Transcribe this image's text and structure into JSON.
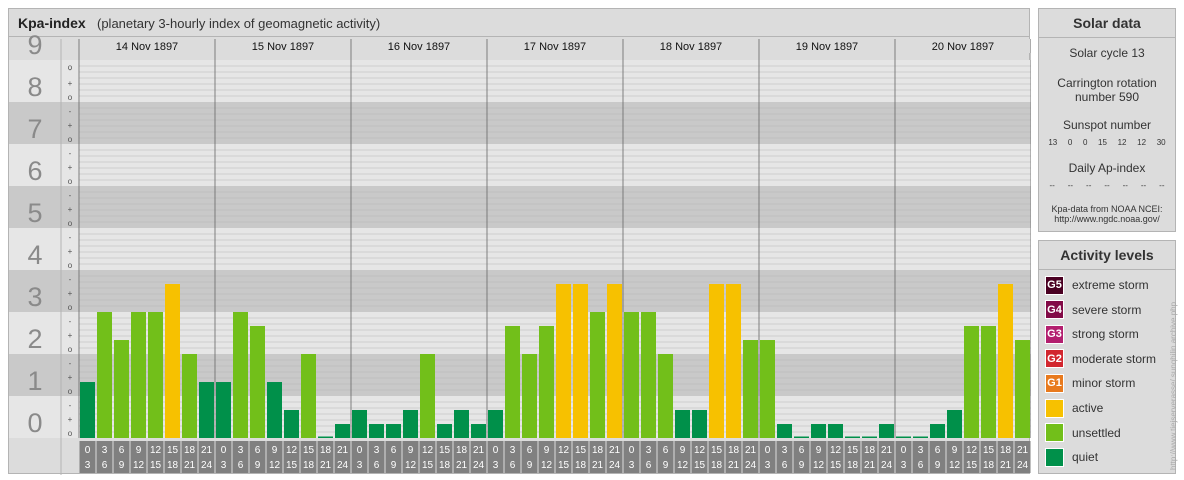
{
  "header": {
    "title": "Kpa-index",
    "subtitle": "(planetary 3-hourly index of geomagnetic activity)"
  },
  "colors": {
    "quiet": "#00904a",
    "unsettled": "#72bf1a",
    "active": "#f7c100",
    "G1": "#e87a1e",
    "G2": "#d2262e",
    "G3": "#b31f6f",
    "G4": "#820a47",
    "G5": "#4a0022"
  },
  "chart_data": {
    "type": "bar",
    "ylim": [
      0,
      9
    ],
    "y_ticks": [
      "0",
      "1",
      "2",
      "3",
      "4",
      "5",
      "6",
      "7",
      "8",
      "9"
    ],
    "thirds_labels": [
      "o",
      "+",
      "-"
    ],
    "days": [
      "14 Nov 1897",
      "15 Nov 1897",
      "16 Nov 1897",
      "17 Nov 1897",
      "18 Nov 1897",
      "19 Nov 1897",
      "20 Nov 1897"
    ],
    "interval_labels": [
      [
        "0",
        "3"
      ],
      [
        "3",
        "6"
      ],
      [
        "6",
        "9"
      ],
      [
        "9",
        "12"
      ],
      [
        "12",
        "15"
      ],
      [
        "15",
        "18"
      ],
      [
        "18",
        "21"
      ],
      [
        "21",
        "24"
      ]
    ],
    "values": [
      1.333,
      3.0,
      2.333,
      3.0,
      3.0,
      3.667,
      2.0,
      1.333,
      1.333,
      3.0,
      2.667,
      1.333,
      0.667,
      2.0,
      0.0,
      0.333,
      0.667,
      0.333,
      0.333,
      0.667,
      2.0,
      0.333,
      0.667,
      0.333,
      0.667,
      2.667,
      2.0,
      2.667,
      3.667,
      3.667,
      3.0,
      3.667,
      3.0,
      3.0,
      2.0,
      0.667,
      0.667,
      3.667,
      3.667,
      2.333,
      2.333,
      0.333,
      0.0,
      0.333,
      0.333,
      0.0,
      0.0,
      0.333,
      0.0,
      0.0,
      0.333,
      0.667,
      2.667,
      2.667,
      3.667,
      2.333
    ]
  },
  "solar": {
    "title": "Solar data",
    "cycle": "Solar cycle 13",
    "carrington_1": "Carrington rotation",
    "carrington_2": "number 590",
    "sunspot_label": "Sunspot number",
    "sunspots": [
      "13",
      "0",
      "0",
      "15",
      "12",
      "12",
      "30"
    ],
    "ap_label": "Daily Ap-index",
    "ap_values": [
      "--",
      "--",
      "--",
      "--",
      "--",
      "--",
      "--"
    ],
    "source_1": "Kpa-data from NOAA NCEI:",
    "source_2": "http://www.ngdc.noaa.gov/"
  },
  "activity": {
    "title": "Activity levels",
    "levels": [
      {
        "badge": "G5",
        "label": "extreme storm",
        "color": "#4a0022"
      },
      {
        "badge": "G4",
        "label": "severe storm",
        "color": "#820a47"
      },
      {
        "badge": "G3",
        "label": "strong storm",
        "color": "#b31f6f"
      },
      {
        "badge": "G2",
        "label": "moderate storm",
        "color": "#d2262e"
      },
      {
        "badge": "G1",
        "label": "minor storm",
        "color": "#e87a1e"
      },
      {
        "badge": "",
        "label": "active",
        "color": "#f7c100"
      },
      {
        "badge": "",
        "label": "unsettled",
        "color": "#72bf1a"
      },
      {
        "badge": "",
        "label": "quiet",
        "color": "#00904a"
      }
    ]
  },
  "credit": "http://www.tiejserverasse/.sunqhilin archive.php"
}
